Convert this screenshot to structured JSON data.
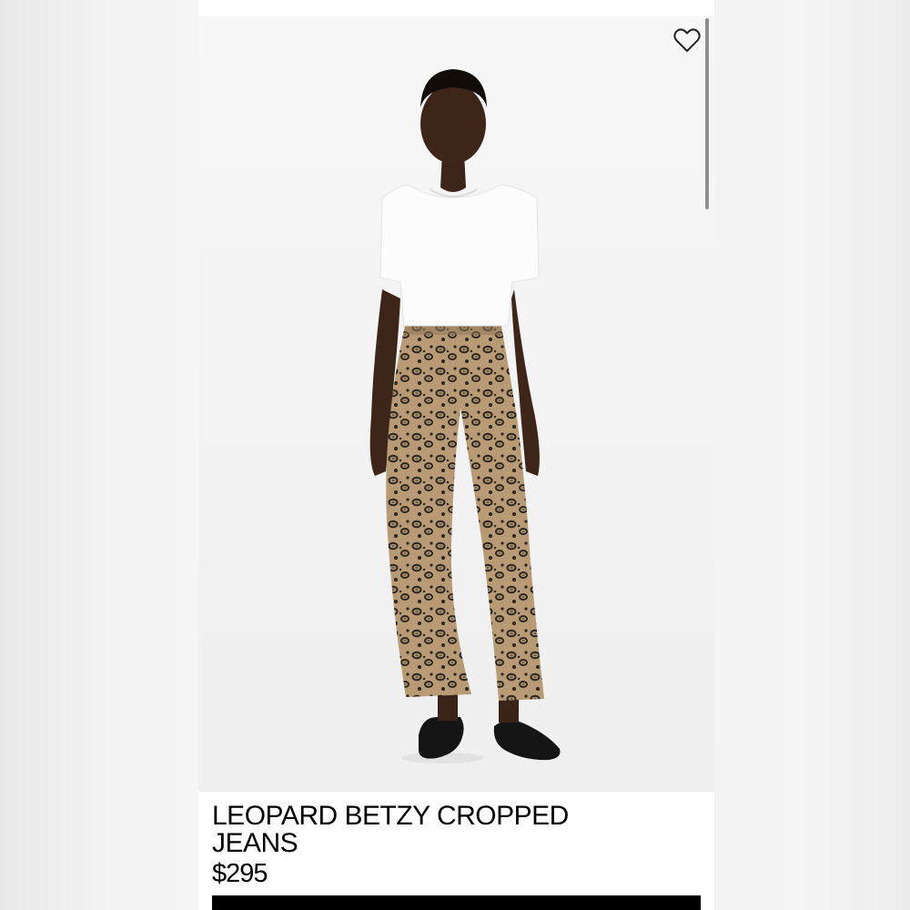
{
  "product": {
    "title_line1": "LEOPARD BETZY CROPPED",
    "title_line2": "JEANS",
    "price": "$295",
    "image_alt": "Model wearing leopard print cropped flare jeans with a white t-shirt and black lace-up shoes"
  },
  "icons": {
    "favorite": "heart-outline-icon"
  },
  "colors": {
    "page_background": "#f1f1f1",
    "card_background": "#ffffff",
    "text": "#000000",
    "cta_bar": "#000000",
    "scrollbar": "#8f8f8f"
  }
}
